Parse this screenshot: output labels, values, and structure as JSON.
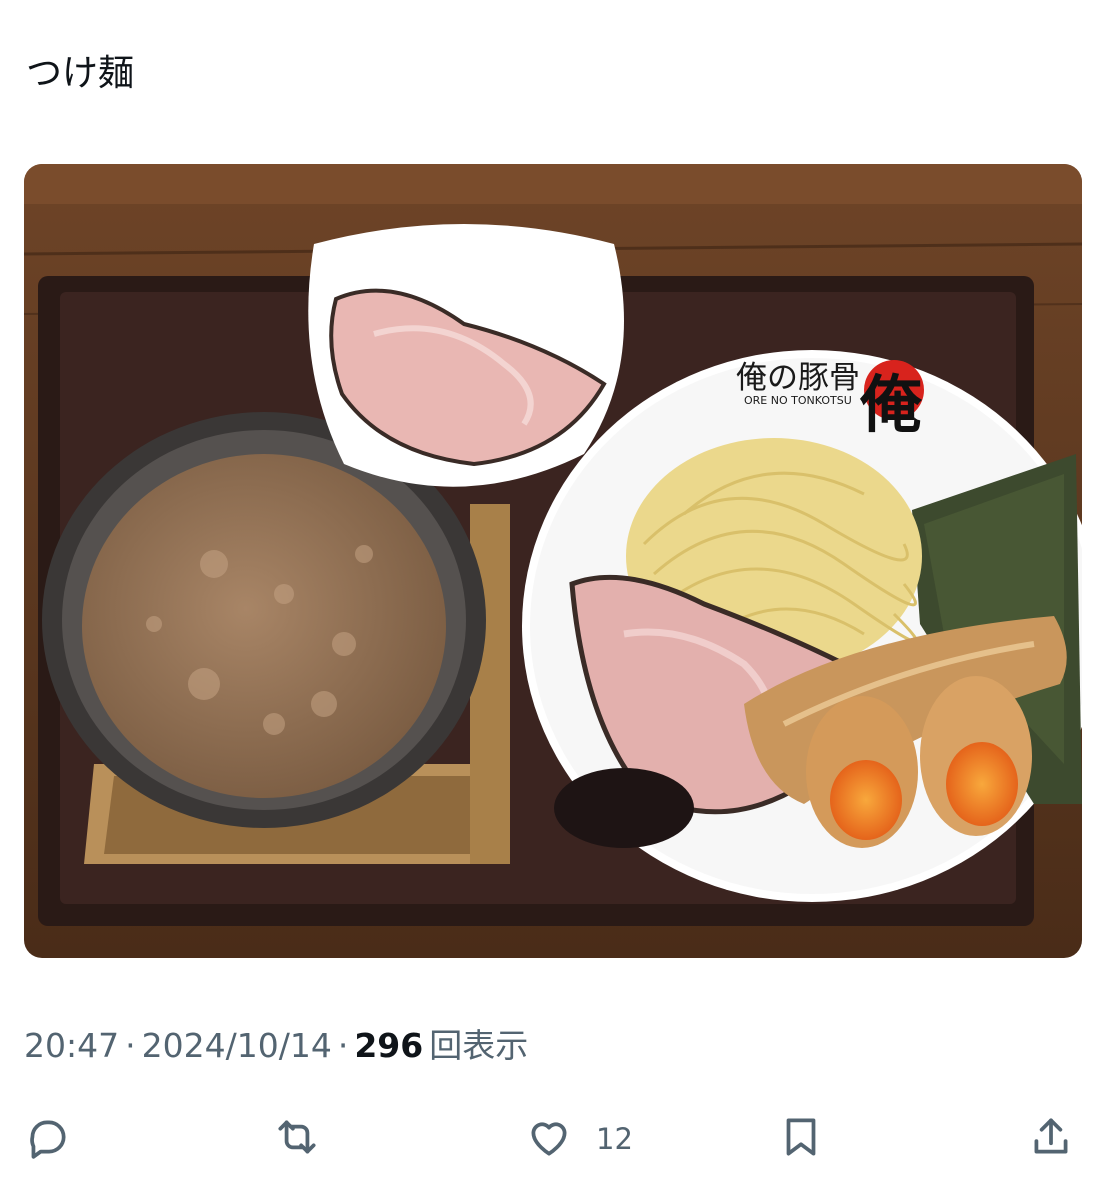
{
  "post": {
    "text": "つけ麺",
    "time": "20:47",
    "separator": "·",
    "date": "2024/10/14",
    "views_count": "296",
    "views_label": "回表示"
  },
  "photo": {
    "bowl_brand": "俺の豚骨",
    "bowl_brand_romaji": "ORE NO TONKOTSU",
    "bowl_logo": "俺"
  },
  "actions": [
    {
      "name": "reply",
      "icon": "speech-bubble-icon",
      "count": ""
    },
    {
      "name": "repost",
      "icon": "repost-arrows-icon",
      "count": ""
    },
    {
      "name": "like",
      "icon": "heart-icon",
      "count": "12"
    },
    {
      "name": "bookmark",
      "icon": "bookmark-icon",
      "count": ""
    },
    {
      "name": "share",
      "icon": "share-upload-icon",
      "count": ""
    }
  ],
  "colors": {
    "text_primary": "#0f1419",
    "text_secondary": "#536471",
    "accent_red": "#d8231d"
  }
}
